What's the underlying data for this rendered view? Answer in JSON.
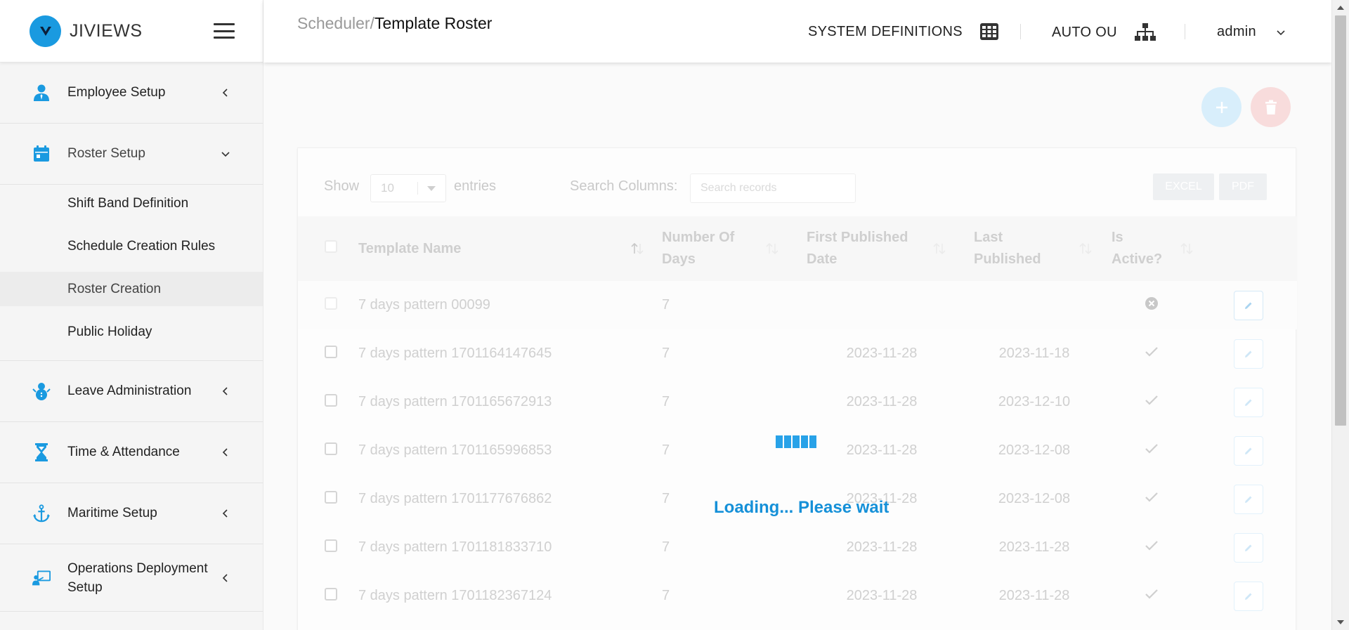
{
  "brand": {
    "name": "JIVIEWS",
    "logo_glyph": "V",
    "color": "#1a9ae0"
  },
  "sidebar": {
    "items": [
      {
        "label": "Employee Setup",
        "icon": "employee-icon"
      },
      {
        "label": "Roster Setup",
        "icon": "calendar-icon",
        "expanded": true,
        "children": [
          {
            "label": "Shift Band Definition"
          },
          {
            "label": "Schedule Creation Rules"
          },
          {
            "label": "Roster Creation",
            "active": true
          },
          {
            "label": "Public Holiday"
          }
        ]
      },
      {
        "label": "Leave Administration",
        "icon": "snowman-icon"
      },
      {
        "label": "Time & Attendance",
        "icon": "hourglass-icon"
      },
      {
        "label": "Maritime Setup",
        "icon": "anchor-icon"
      },
      {
        "label": "Operations Deployment Setup",
        "label_line1": "Operations Deployment",
        "label_line2": "Setup",
        "icon": "deployment-icon"
      }
    ]
  },
  "header": {
    "breadcrumb_parent": "Scheduler",
    "breadcrumb_sep": "/",
    "breadcrumb_current": "Template Roster",
    "system_definitions": "SYSTEM DEFINITIONS",
    "auto_ou": "AUTO OU",
    "user": "admin"
  },
  "toolbar": {
    "show_label": "Show",
    "entries_value": "10",
    "entries_label": "entries",
    "search_label": "Search Columns:",
    "search_placeholder": "Search records",
    "excel_label": "EXCEL",
    "pdf_label": "PDF"
  },
  "table": {
    "columns": [
      {
        "label": "Template Name"
      },
      {
        "label_line1": "Number Of",
        "label_line2": "Days"
      },
      {
        "label_line1": "First Published",
        "label_line2": "Date"
      },
      {
        "label_line1": "Last",
        "label_line2": "Published"
      },
      {
        "label_line1": "Is",
        "label_line2": "Active?"
      }
    ],
    "rows": [
      {
        "name": "7 days pattern 00099",
        "days": "7",
        "first": "",
        "last": "",
        "active": false
      },
      {
        "name": "7 days pattern 1701164147645",
        "days": "7",
        "first": "2023-11-28",
        "last": "2023-11-18",
        "active": true
      },
      {
        "name": "7 days pattern 1701165672913",
        "days": "7",
        "first": "2023-11-28",
        "last": "2023-12-10",
        "active": true
      },
      {
        "name": "7 days pattern 1701165996853",
        "days": "7",
        "first": "2023-11-28",
        "last": "2023-12-08",
        "active": true
      },
      {
        "name": "7 days pattern 1701177676862",
        "days": "7",
        "first": "2023-11-28",
        "last": "2023-12-08",
        "active": true
      },
      {
        "name": "7 days pattern 1701181833710",
        "days": "7",
        "first": "2023-11-28",
        "last": "2023-11-28",
        "active": true
      },
      {
        "name": "7 days pattern 1701182367124",
        "days": "7",
        "first": "2023-11-28",
        "last": "2023-11-28",
        "active": true
      }
    ]
  },
  "loading": {
    "text": "Loading... Please wait"
  },
  "colors": {
    "accent": "#1a9ae0",
    "loading_text": "#1590d8",
    "add_fab": "#d8eefb",
    "delete_fab": "#f8dcdc"
  }
}
